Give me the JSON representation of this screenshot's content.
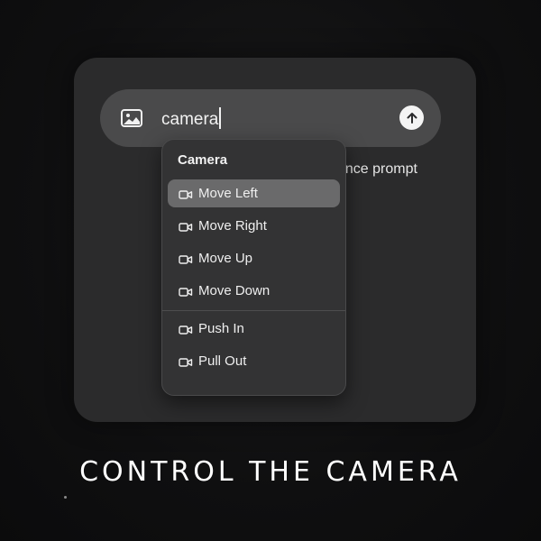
{
  "prompt": {
    "value": "camera",
    "hint": "ance prompt"
  },
  "dropdown": {
    "header": "Camera",
    "items": [
      {
        "label": "Move Left",
        "icon": "video-camera-icon",
        "active": true
      },
      {
        "label": "Move Right",
        "icon": "video-camera-icon",
        "active": false
      },
      {
        "label": "Move Up",
        "icon": "video-camera-icon",
        "active": false
      },
      {
        "label": "Move Down",
        "icon": "video-camera-icon",
        "active": false
      },
      {
        "label": "Push In",
        "icon": "video-camera-icon",
        "active": false
      },
      {
        "label": "Pull Out",
        "icon": "video-camera-icon",
        "active": false
      }
    ]
  },
  "caption": "CONTROL THE CAMERA",
  "icons": {
    "image": "image-icon",
    "send": "arrow-up-icon"
  },
  "colors": {
    "panel": "#2b2b2c",
    "prompt_bar": "#4a4a4b",
    "active_item": "#6a6a6b",
    "background": "#0e0e0f"
  }
}
